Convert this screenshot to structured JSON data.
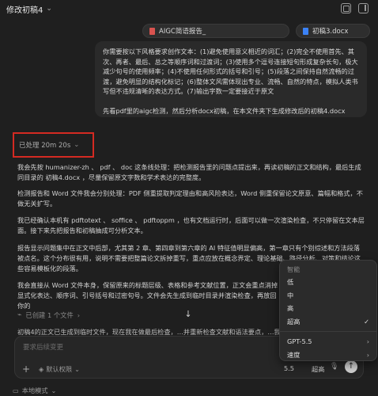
{
  "window": {
    "title": "修改初稿4"
  },
  "attachments": [
    {
      "name": "AIGC简语报告_",
      "type": "pdf"
    },
    {
      "name": "初稿3.docx",
      "type": "docx"
    }
  ],
  "user_message": {
    "paragraph1": "你需要按以下风格要求创作文本：(1)避免使用意义相近的词汇；(2)完全不使用首先、其次、再者、最后、总之等顺序词和过渡词；(3)使用多个逗号连接短句形成复杂长句，极大减少句号的使用频率；(4)不使用任何形式的括号和引号；(5)段落之间保持自然流畅的过渡，避免明显的结构化标记；(6)整体文风需体现出专业、流畅、自然的特点，模拟人类书写但不违规清晰的表达方式。(7)输出字数一定要接近于原文",
    "paragraph2": "先看pdf里的aigc检测，然后分析docx初稿，在本文件夹下生成修改后的初稿4.docx"
  },
  "status": {
    "processed": "已处理 20m 20s"
  },
  "response": {
    "p1": "我会先按 humanizer-zh 、 pdf 、 doc 这条线处理：把检测报告里的问题点提出来，再读初稿的正文和结构，最后生成同目录的 初稿4.docx ，尽量保留原文字数和学术表达的完整度。",
    "p2": "检测报告和 Word 文件我会分别处理：PDF 侧重提取判定理由和高风险表达，Word 侧重保留论文原意、篇幅和格式，不做无关扩写。",
    "p3": "我已经确认本机有 pdftotext 、 soffice 、 pdftoppm ，也有文档运行时，后面可以做一次渲染检查，不只停留在文本层面。接下来先把报告和初稿抽成可分析文本。",
    "p4": "报告显示问题集中在正文中后部，尤其第 2 章、第四章到第六章的 AI 特征值明显偏高，第一章只有个别综述和方法段落被点名。这个分布很有用，说明不需要把整篇论文拆掉重写，重点应放在概念界定、理论基础、路径分析、对策和结论这些容易模板化的段落。",
    "p5": "我会直接从 Word 文件本身，保留原来的标题层级、表格和参考文献位置，正文会重点消掉显式化表达、顺序词、引号括号和过密句号。文件会先生成到临时目录并渲染检查，再放回你的"
  },
  "created": {
    "label": "已创建 1 个文件"
  },
  "trailing_line": "初稿4的正文已生成到临时文件，现在我在做最后检查，…并重新检查文献和语法要点，…我打算检查",
  "composer": {
    "placeholder": "要求后续变更",
    "permission": "默认权限",
    "model": "5.5",
    "level": "超高"
  },
  "footer": {
    "mode": "本地模式"
  },
  "menu": {
    "header": "智能",
    "levels": [
      "低",
      "中",
      "高",
      "超高"
    ],
    "checked_index": 3,
    "model_label": "GPT-5.5",
    "speed_label": "速度"
  }
}
